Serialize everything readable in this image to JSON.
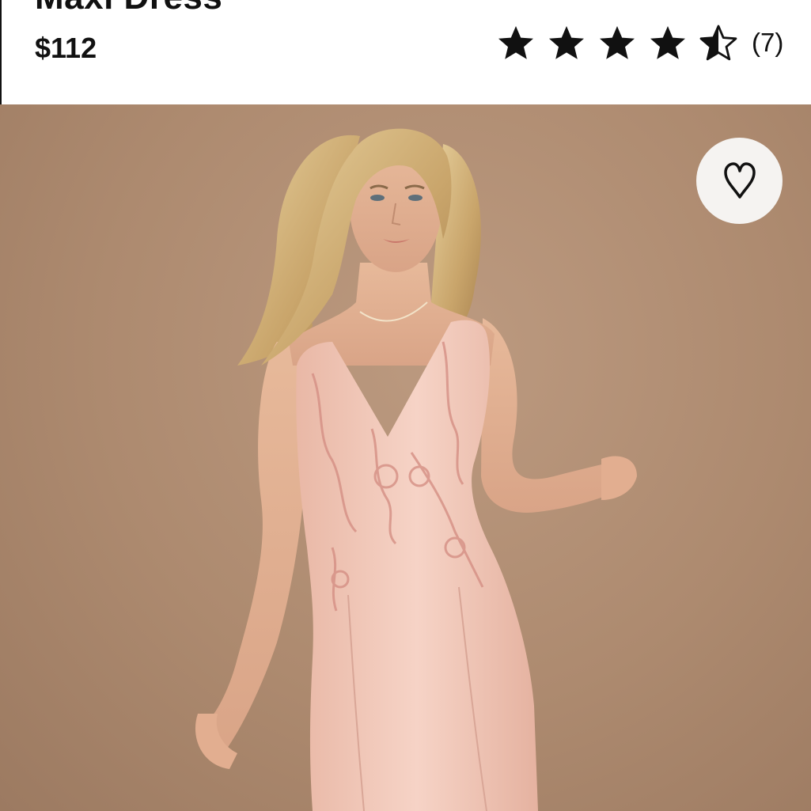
{
  "product": {
    "title": "Maxi Dress",
    "price": "$112",
    "rating": 4.5,
    "rating_max": 5,
    "review_count": "(7)"
  },
  "icons": {
    "star": "star-icon",
    "half_star": "half-star-icon",
    "wishlist": "heart-outline-icon"
  },
  "colors": {
    "text": "#111111",
    "photo_background": "#ad8a6f",
    "dress": "#f1c6b8",
    "wishlist_bg": "#f5f3f1"
  }
}
